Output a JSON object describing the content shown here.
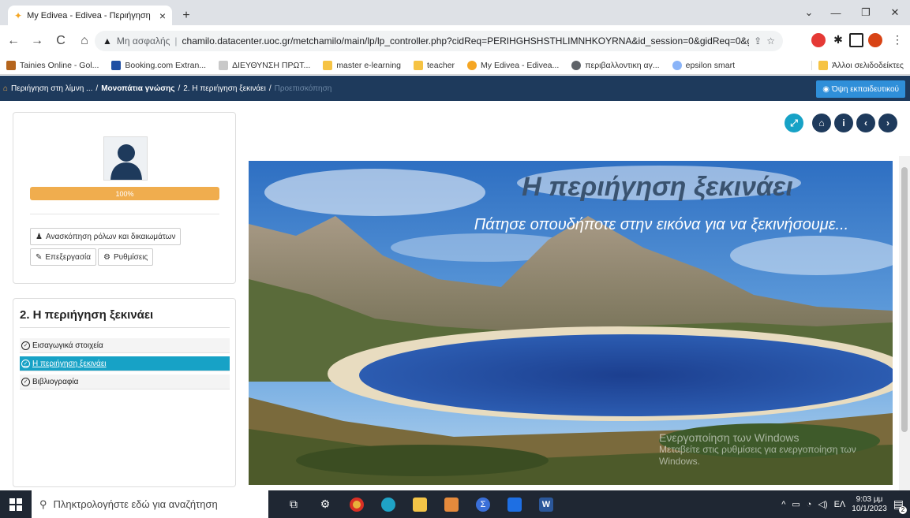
{
  "browser": {
    "tab_title": "My Edivea - Edivea - Περιήγηση",
    "tab_close": "×",
    "new_tab": "+",
    "security_label": "Μη ασφαλής",
    "url": "chamilo.datacenter.uoc.gr/metchamilo/main/lp/lp_controller.php?cidReq=PERIHGHSHSTHLIMNHKOYRNA&id_session=0&gidReq=0&gr...",
    "bookmarks": [
      {
        "label": "Tainies Online - Gol...",
        "color": "#b5651d"
      },
      {
        "label": "Booking.com Extran...",
        "color": "#1f4fa3"
      },
      {
        "label": "ΔΙΕΥΘΥΝΣΗ ΠΡΩΤ...",
        "color": "#9aa0a6"
      },
      {
        "label": "master e-learning",
        "color": "#f6c343"
      },
      {
        "label": "teacher",
        "color": "#f6c343"
      },
      {
        "label": "My Edivea - Edivea...",
        "color": "#f5a623"
      },
      {
        "label": "περιβαλλοντικη αγ...",
        "color": "#5f6368"
      },
      {
        "label": "epsilon smart",
        "color": "#8ab4f8"
      }
    ],
    "other_bookmarks": "Άλλοι σελιδοδείκτες"
  },
  "lms": {
    "breadcrumb": [
      "Περιήγηση στη λίμνη ...",
      "Μονοπάτια γνώσης",
      "2. Η περιήγηση ξεκινάει",
      "Προεπισκόπηση"
    ],
    "crumb_sep": "/",
    "teacher_view": "Όψη εκπαιδευτικού",
    "progress": "100%",
    "progress_value": 1.0,
    "buttons": {
      "roles": "Ανασκόπηση ρόλων και δικαιωμάτων",
      "edit": "Επεξεργασία",
      "settings": "Ρυθμίσεις"
    },
    "toc_title": "2. Η περιήγηση ξεκινάει",
    "toc_items": [
      {
        "label": "Εισαγωγικά στοιχεία",
        "active": false
      },
      {
        "label": "Η περιήγηση ξεκινάει",
        "active": true
      },
      {
        "label": "Βιβλιογραφία",
        "active": false
      }
    ],
    "slide_title": "Η περιήγηση ξεκινάει",
    "slide_subtitle": "Πάτησε οπουδήποτε στην εικόνα για να ξεκινήσουμε...",
    "watermark_title": "Ενεργοποίηση των Windows",
    "watermark_text": "Μεταβείτε στις ρυθμίσεις για ενεργοποίηση των Windows."
  },
  "taskbar": {
    "search_placeholder": "Πληκτρολογήστε εδώ για αναζήτηση",
    "lang": "ΕΛ",
    "time": "9:03 μμ",
    "date": "10/1/2023",
    "notifications": "2"
  },
  "colors": {
    "lms_header": "#1e3a5c",
    "progress": "#f0ad4e",
    "active_item": "#17a2c6"
  }
}
